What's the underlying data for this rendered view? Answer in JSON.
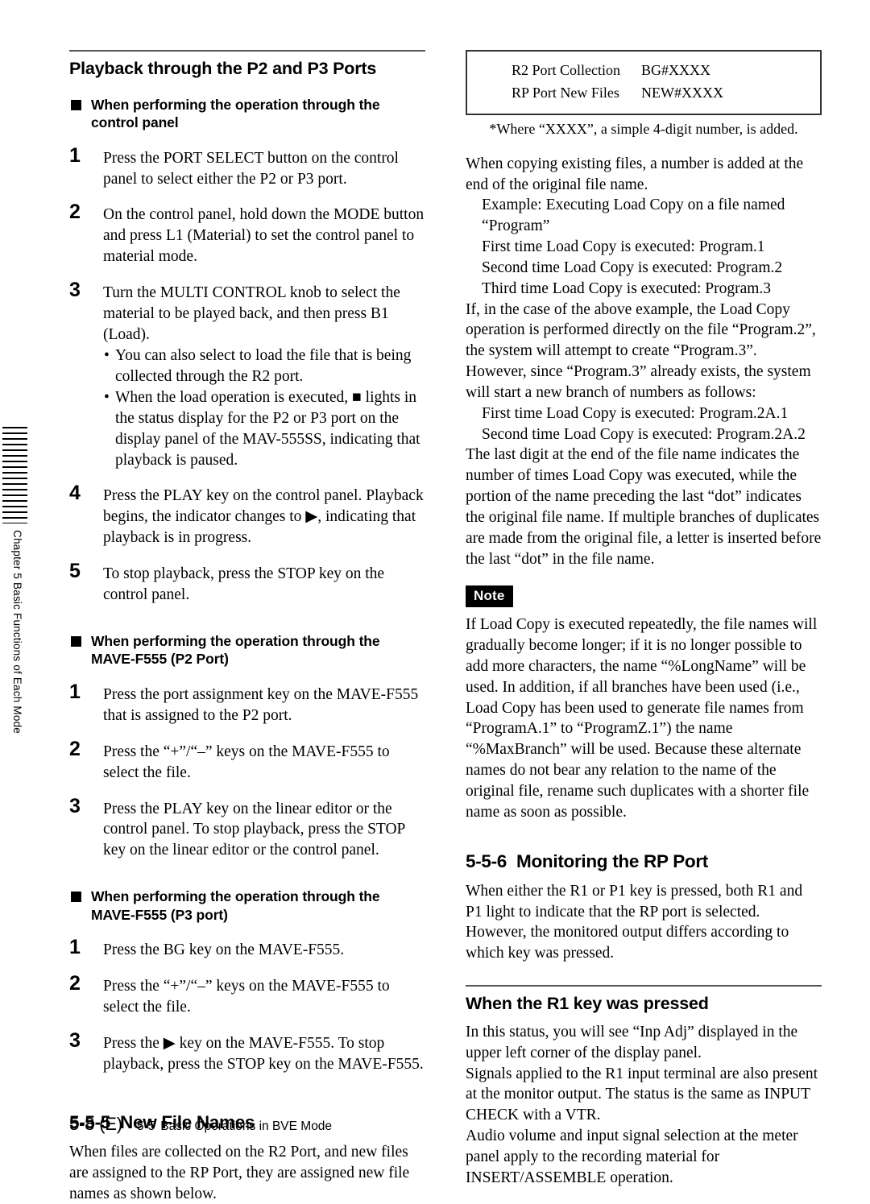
{
  "margin": {
    "chapter_label": "Chapter 5   Basic Functions of Each Mode"
  },
  "left_column": {
    "heading": "Playback through the P2 and P3 Ports",
    "group1": {
      "heading": "When performing the operation through the control panel",
      "steps": [
        {
          "number": "1",
          "text": "Press the PORT SELECT button on the control panel to select either the P2 or P3 port."
        },
        {
          "number": "2",
          "text": "On the control panel, hold down the MODE button and press L1 (Material) to set the control panel to material mode."
        },
        {
          "number": "3",
          "text": "Turn the MULTI CONTROL knob to select the material to be played back, and then press B1 (Load).",
          "bullets": [
            "You can also select to load the file that is being collected through the R2 port.",
            "When the load operation is executed, ■ lights in the status display for the P2 or P3 port on the display panel of the MAV-555SS, indicating that playback is paused."
          ]
        },
        {
          "number": "4",
          "text": "Press the PLAY key on the control panel. Playback begins, the indicator changes to ▶, indicating that playback is in progress."
        },
        {
          "number": "5",
          "text": "To stop playback, press the STOP key on the control panel."
        }
      ]
    },
    "group2": {
      "heading": "When performing the operation through the MAVE-F555 (P2 Port)",
      "steps": [
        {
          "number": "1",
          "text": "Press the port assignment key on the MAVE-F555 that is assigned to the P2 port."
        },
        {
          "number": "2",
          "text": "Press the “+”/“–” keys on the MAVE-F555 to select the file."
        },
        {
          "number": "3",
          "text": "Press the PLAY key on the linear editor or the control panel.  To stop playback, press the STOP key on the linear editor or the control panel."
        }
      ]
    },
    "group3": {
      "heading": "When performing the operation through the MAVE-F555 (P3 port)",
      "steps": [
        {
          "number": "1",
          "text": "Press the BG key on the MAVE-F555."
        },
        {
          "number": "2",
          "text": "Press the “+”/“–” keys on the MAVE-F555 to select the file."
        },
        {
          "number": "3",
          "text": "Press the ▶ key on the MAVE-F555.  To stop playback, press the STOP key on the MAVE-F555."
        }
      ]
    },
    "section_555": {
      "number": "5-5-5",
      "title": "New File Names",
      "body": "When files are collected on the R2 Port, and new files are assigned to the RP Port, they are assigned new file names as shown below."
    }
  },
  "right_column": {
    "table": {
      "rows": [
        {
          "label": "R2 Port Collection",
          "value": "BG#XXXX"
        },
        {
          "label": "RP Port New Files",
          "value": "NEW#XXXX"
        }
      ],
      "footnote": "*Where “XXXX”, a simple 4-digit number, is added."
    },
    "para1": "When copying existing files, a number is added at the end of the original file name.",
    "example_lines": [
      "Example: Executing Load Copy on a file named “Program”",
      "First time Load Copy is executed: Program.1",
      "Second time Load Copy is executed: Program.2",
      "Third time Load Copy is executed: Program.3"
    ],
    "para2": "If, in the case of the above example, the Load Copy operation is performed directly on the file “Program.2”, the system will attempt to create “Program.3”.  However, since “Program.3” already exists, the system will start a new branch of numbers as follows:",
    "branch_lines": [
      "First time Load Copy is executed: Program.2A.1",
      "Second time Load Copy is executed: Program.2A.2"
    ],
    "para3": "The last digit at the end of the file name indicates the number of times Load Copy was executed, while the portion of the name preceding the last “dot” indicates the original file name.  If multiple branches of duplicates are made from the original file, a letter is inserted before the last “dot” in the file name.",
    "note_badge": "Note",
    "note_body": "If Load Copy is executed repeatedly, the file names will gradually become longer; if it is no longer possible to add more characters, the name “%LongName” will be used.  In addition, if all branches have been used (i.e., Load Copy has been used to generate file names from “ProgramA.1” to “ProgramZ.1”) the name “%MaxBranch” will be used. Because these alternate names do not bear any relation to the name of the original file, rename such duplicates with a shorter file name as soon as possible.",
    "section_556": {
      "number": "5-5-6",
      "title": "Monitoring the RP Port",
      "body": "When either the R1 or P1 key is pressed, both R1 and P1 light to indicate that the RP port is selected. However, the monitored output differs according to which key was pressed."
    },
    "r1_heading": "When the R1 key was pressed",
    "r1_paras": [
      "In this status, you will see “Inp Adj” displayed in the upper left corner of the display panel.",
      "Signals applied to the R1 input terminal are also present at the monitor output. The status is the same as INPUT CHECK with a VTR.",
      "Audio volume and input signal selection at the meter panel apply to the recording material for INSERT/ASSEMBLE operation."
    ]
  },
  "footer": {
    "page": "5-8 (E)",
    "section_number": "5-5",
    "section_title": "Basic Operations in BVE Mode"
  }
}
